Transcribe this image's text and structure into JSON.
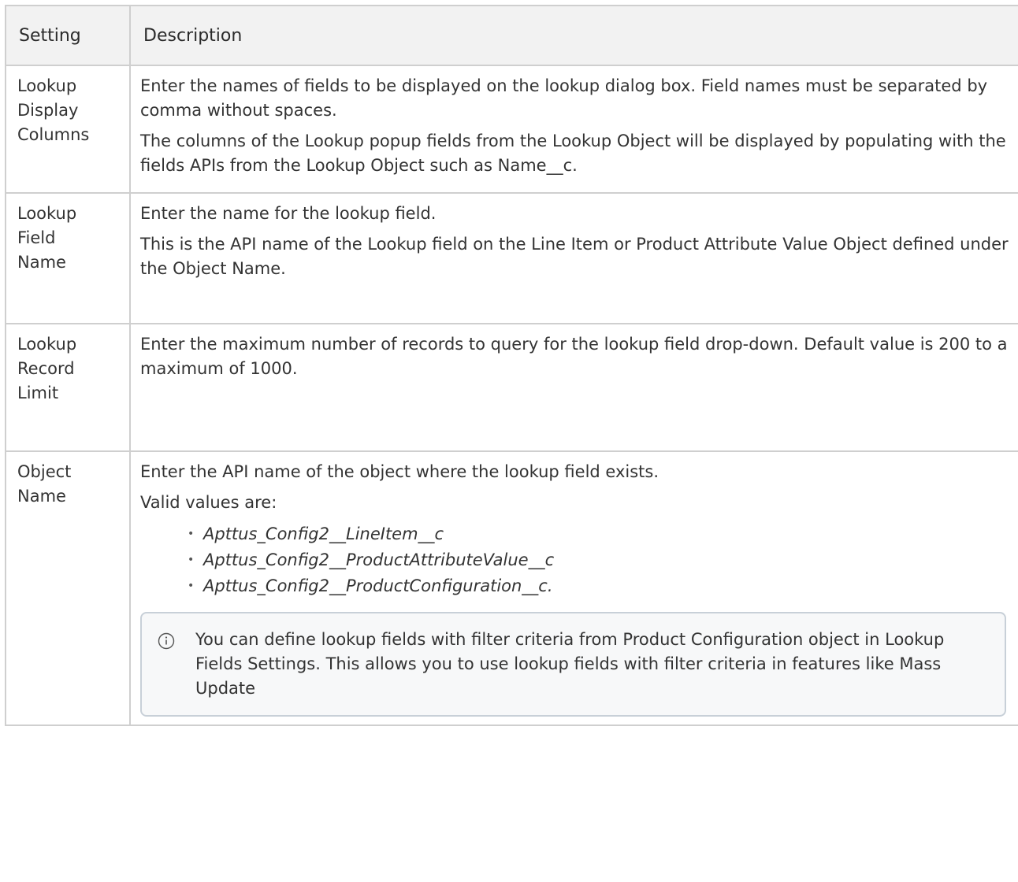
{
  "table": {
    "headers": [
      "Setting",
      "Description"
    ],
    "rows": [
      {
        "setting": [
          "Lookup",
          "Display",
          "Columns"
        ],
        "paragraphs": [
          "Enter the names of fields to be displayed on the lookup dialog box. Field names must be separated by comma without spaces.",
          "The columns of the Lookup popup fields from the Lookup Object will be displayed by populating with the fields APIs from the Lookup Object such as Name__c."
        ]
      },
      {
        "setting": [
          "Lookup",
          "Field",
          "Name"
        ],
        "paragraphs": [
          "Enter the name for the lookup field.",
          "This is the API name of the Lookup field on the Line Item or Product Attribute Value Object defined under the Object Name."
        ]
      },
      {
        "setting": [
          "Lookup",
          "Record",
          "Limit"
        ],
        "paragraphs": [
          "Enter the maximum number of records to query for the lookup field drop-down. Default value is 200 to a maximum of 1000."
        ]
      },
      {
        "setting": [
          "Object",
          "Name"
        ],
        "paragraphs": [
          "Enter the API name of the object where the lookup field exists.",
          "Valid values are:"
        ],
        "values": [
          "Apttus_Config2__LineItem__c",
          "Apttus_Config2__ProductAttributeValue__c",
          "Apttus_Config2__ProductConfiguration__c."
        ],
        "note": "You can define lookup fields with filter criteria from Product Configuration object in Lookup Fields Settings. This allows you to use lookup fields with filter criteria in features like Mass Update",
        "note_icon": "info-icon"
      }
    ]
  }
}
